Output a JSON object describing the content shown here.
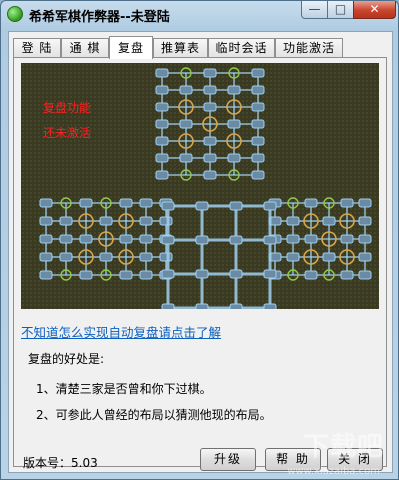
{
  "window": {
    "title": "希希军棋作弊器--未登陆"
  },
  "controls": {
    "minimize": "—",
    "maximize": "□",
    "close": "✕"
  },
  "tabs": [
    {
      "label": "登 陆"
    },
    {
      "label": "通 棋"
    },
    {
      "label": "复盘"
    },
    {
      "label": "推算表"
    },
    {
      "label": "临时会话"
    },
    {
      "label": "功能激活"
    }
  ],
  "board": {
    "notes": [
      "复盘功能",
      "还未激活"
    ],
    "colors": {
      "background": "#3a3a22",
      "line": "#9fd0f0",
      "post": "#6b8aa4",
      "camp": "#d8a64a",
      "station": "#8fc94a",
      "note": "#ff2020"
    }
  },
  "link_text": "不知道怎么实现自动复盘请点击了解",
  "benefits": {
    "title": "复盘的好处是:",
    "items": [
      "1、清楚三家是否曾和你下过棋。",
      "2、可参此人曾经的布局以猜测他现的布局。"
    ]
  },
  "footer": {
    "version_label": "版本号：5.03",
    "buttons": {
      "upgrade": "升级",
      "help": "帮 助",
      "close": "关 闭"
    }
  },
  "watermark": {
    "text": "下载吧",
    "url": "www.xiazaiba.com"
  }
}
